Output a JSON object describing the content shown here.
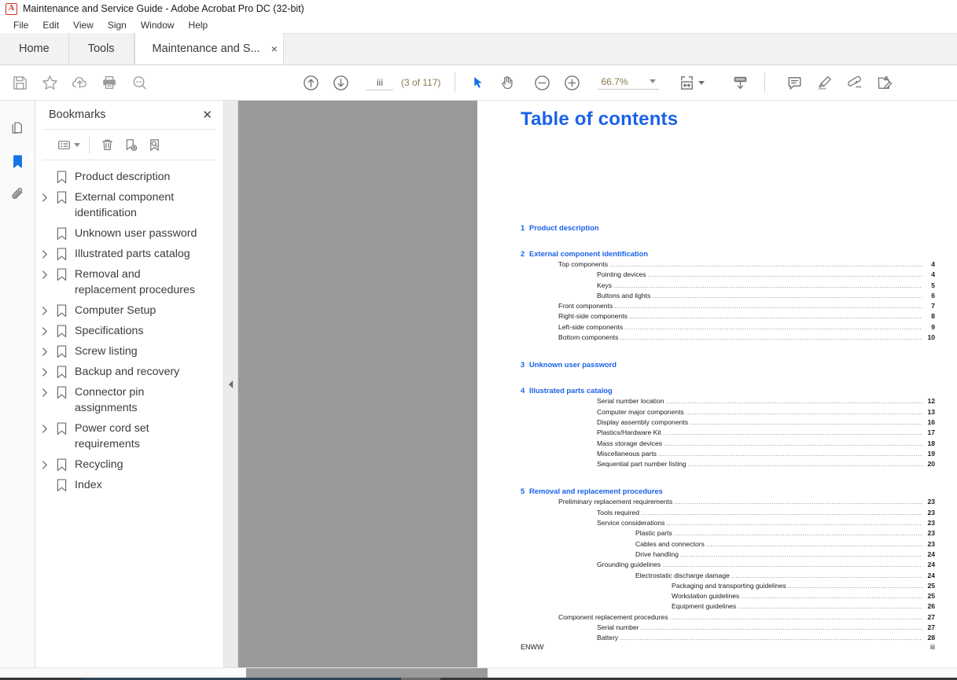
{
  "window": {
    "app_icon": "acrobat-icon",
    "title": "Maintenance and Service Guide - Adobe Acrobat Pro DC (32-bit)"
  },
  "menubar": {
    "items": [
      "File",
      "Edit",
      "View",
      "Sign",
      "Window",
      "Help"
    ]
  },
  "tabs": [
    {
      "label": "Home",
      "active": false
    },
    {
      "label": "Tools",
      "active": false
    },
    {
      "label": "Maintenance and S...",
      "active": true,
      "close": "×"
    }
  ],
  "toolbar": {
    "left_icons": [
      "save-icon",
      "star-icon",
      "cloud-upload-icon",
      "print-icon",
      "search-icon"
    ],
    "navigation": {
      "previous_page_icon": "arrow-up-circle-icon",
      "next_page_icon": "arrow-down-circle-icon",
      "page_value": "iii",
      "page_count": "(3 of 117)"
    },
    "tools": {
      "select_icon": "cursor-arrow-icon",
      "hand_icon": "hand-icon",
      "zoom_out_icon": "minus-circle-icon",
      "zoom_in_icon": "plus-circle-icon",
      "zoom_value": "66.7%",
      "fit_page_icon": "fit-page-icon",
      "download_icon": "download-icon"
    },
    "right_icons": [
      "comment-icon",
      "highlight-icon",
      "draw-icon",
      "fill-and-sign-icon"
    ]
  },
  "rail": {
    "items": [
      {
        "name": "page-thumbnails",
        "active": false
      },
      {
        "name": "bookmarks",
        "active": true
      },
      {
        "name": "attachments",
        "active": false
      }
    ]
  },
  "panel": {
    "title": "Bookmarks",
    "close": "✕",
    "tools": [
      "bookmark-options-icon",
      "delete-bookmark-icon",
      "new-bookmark-icon",
      "find-bookmark-icon"
    ],
    "bookmarks": [
      {
        "label": "Product description",
        "expandable": false
      },
      {
        "label": "External component identification",
        "expandable": true
      },
      {
        "label": "Unknown user password",
        "expandable": false
      },
      {
        "label": "Illustrated parts catalog",
        "expandable": true
      },
      {
        "label": "Removal and replacement procedures",
        "expandable": true
      },
      {
        "label": "Computer Setup",
        "expandable": true
      },
      {
        "label": "Specifications",
        "expandable": true
      },
      {
        "label": "Screw listing",
        "expandable": true
      },
      {
        "label": "Backup and recovery",
        "expandable": true
      },
      {
        "label": "Connector pin assignments",
        "expandable": true
      },
      {
        "label": "Power cord set requirements",
        "expandable": true
      },
      {
        "label": "Recycling",
        "expandable": true
      },
      {
        "label": "Index",
        "expandable": false
      }
    ]
  },
  "document": {
    "heading": "Table of contents",
    "chapters": [
      {
        "num": "1",
        "title": "Product description",
        "entries": []
      },
      {
        "num": "2",
        "title": "External component identification",
        "entries": [
          {
            "level": 1,
            "text": "Top components",
            "page": "4"
          },
          {
            "level": 2,
            "text": "Pointing devices",
            "page": "4"
          },
          {
            "level": 2,
            "text": "Keys",
            "page": "5"
          },
          {
            "level": 2,
            "text": "Buttons and lights",
            "page": "6"
          },
          {
            "level": 1,
            "text": "Front components",
            "page": "7"
          },
          {
            "level": 1,
            "text": "Right-side components",
            "page": "8"
          },
          {
            "level": 1,
            "text": "Left-side components",
            "page": "9"
          },
          {
            "level": 1,
            "text": "Bottom components",
            "page": "10"
          }
        ]
      },
      {
        "num": "3",
        "title": "Unknown user password",
        "entries": []
      },
      {
        "num": "4",
        "title": "Illustrated parts catalog",
        "entries": [
          {
            "level": 1,
            "text": "Serial number location",
            "page": "12"
          },
          {
            "level": 1,
            "text": "Computer major components",
            "page": "13"
          },
          {
            "level": 1,
            "text": "Display assembly components",
            "page": "16"
          },
          {
            "level": 1,
            "text": "Plastics/Hardware Kit",
            "page": "17"
          },
          {
            "level": 1,
            "text": "Mass storage devices",
            "page": "18"
          },
          {
            "level": 1,
            "text": "Miscellaneous parts",
            "page": "19"
          },
          {
            "level": 1,
            "text": "Sequential part number listing",
            "page": "20"
          }
        ]
      },
      {
        "num": "5",
        "title": "Removal and replacement procedures",
        "entries": [
          {
            "level": 1,
            "text": "Preliminary replacement requirements",
            "page": "23"
          },
          {
            "level": 2,
            "text": "Tools required",
            "page": "23"
          },
          {
            "level": 2,
            "text": "Service considerations",
            "page": "23"
          },
          {
            "level": 3,
            "text": "Plastic parts",
            "page": "23"
          },
          {
            "level": 3,
            "text": "Cables and connectors",
            "page": "23"
          },
          {
            "level": 3,
            "text": "Drive handling",
            "page": "24"
          },
          {
            "level": 2,
            "text": "Grounding guidelines",
            "page": "24"
          },
          {
            "level": 3,
            "text": "Electrostatic discharge damage",
            "page": "24"
          },
          {
            "level": 4,
            "text": "Packaging and transporting guidelines",
            "page": "25"
          },
          {
            "level": 4,
            "text": "Workstation guidelines",
            "page": "25"
          },
          {
            "level": 4,
            "text": "Equipment guidelines",
            "page": "26"
          },
          {
            "level": 1,
            "text": "Component replacement procedures",
            "page": "27"
          },
          {
            "level": 2,
            "text": "Serial number",
            "page": "27"
          },
          {
            "level": 2,
            "text": "Battery",
            "page": "28"
          }
        ]
      }
    ],
    "footer_left": "ENWW",
    "footer_right": "iii"
  },
  "colors": {
    "heading_blue": "#1a62e8",
    "accent_blue": "#1473e6",
    "toolbar_text": "#8a7a4a",
    "viewer_background": "#999999"
  }
}
